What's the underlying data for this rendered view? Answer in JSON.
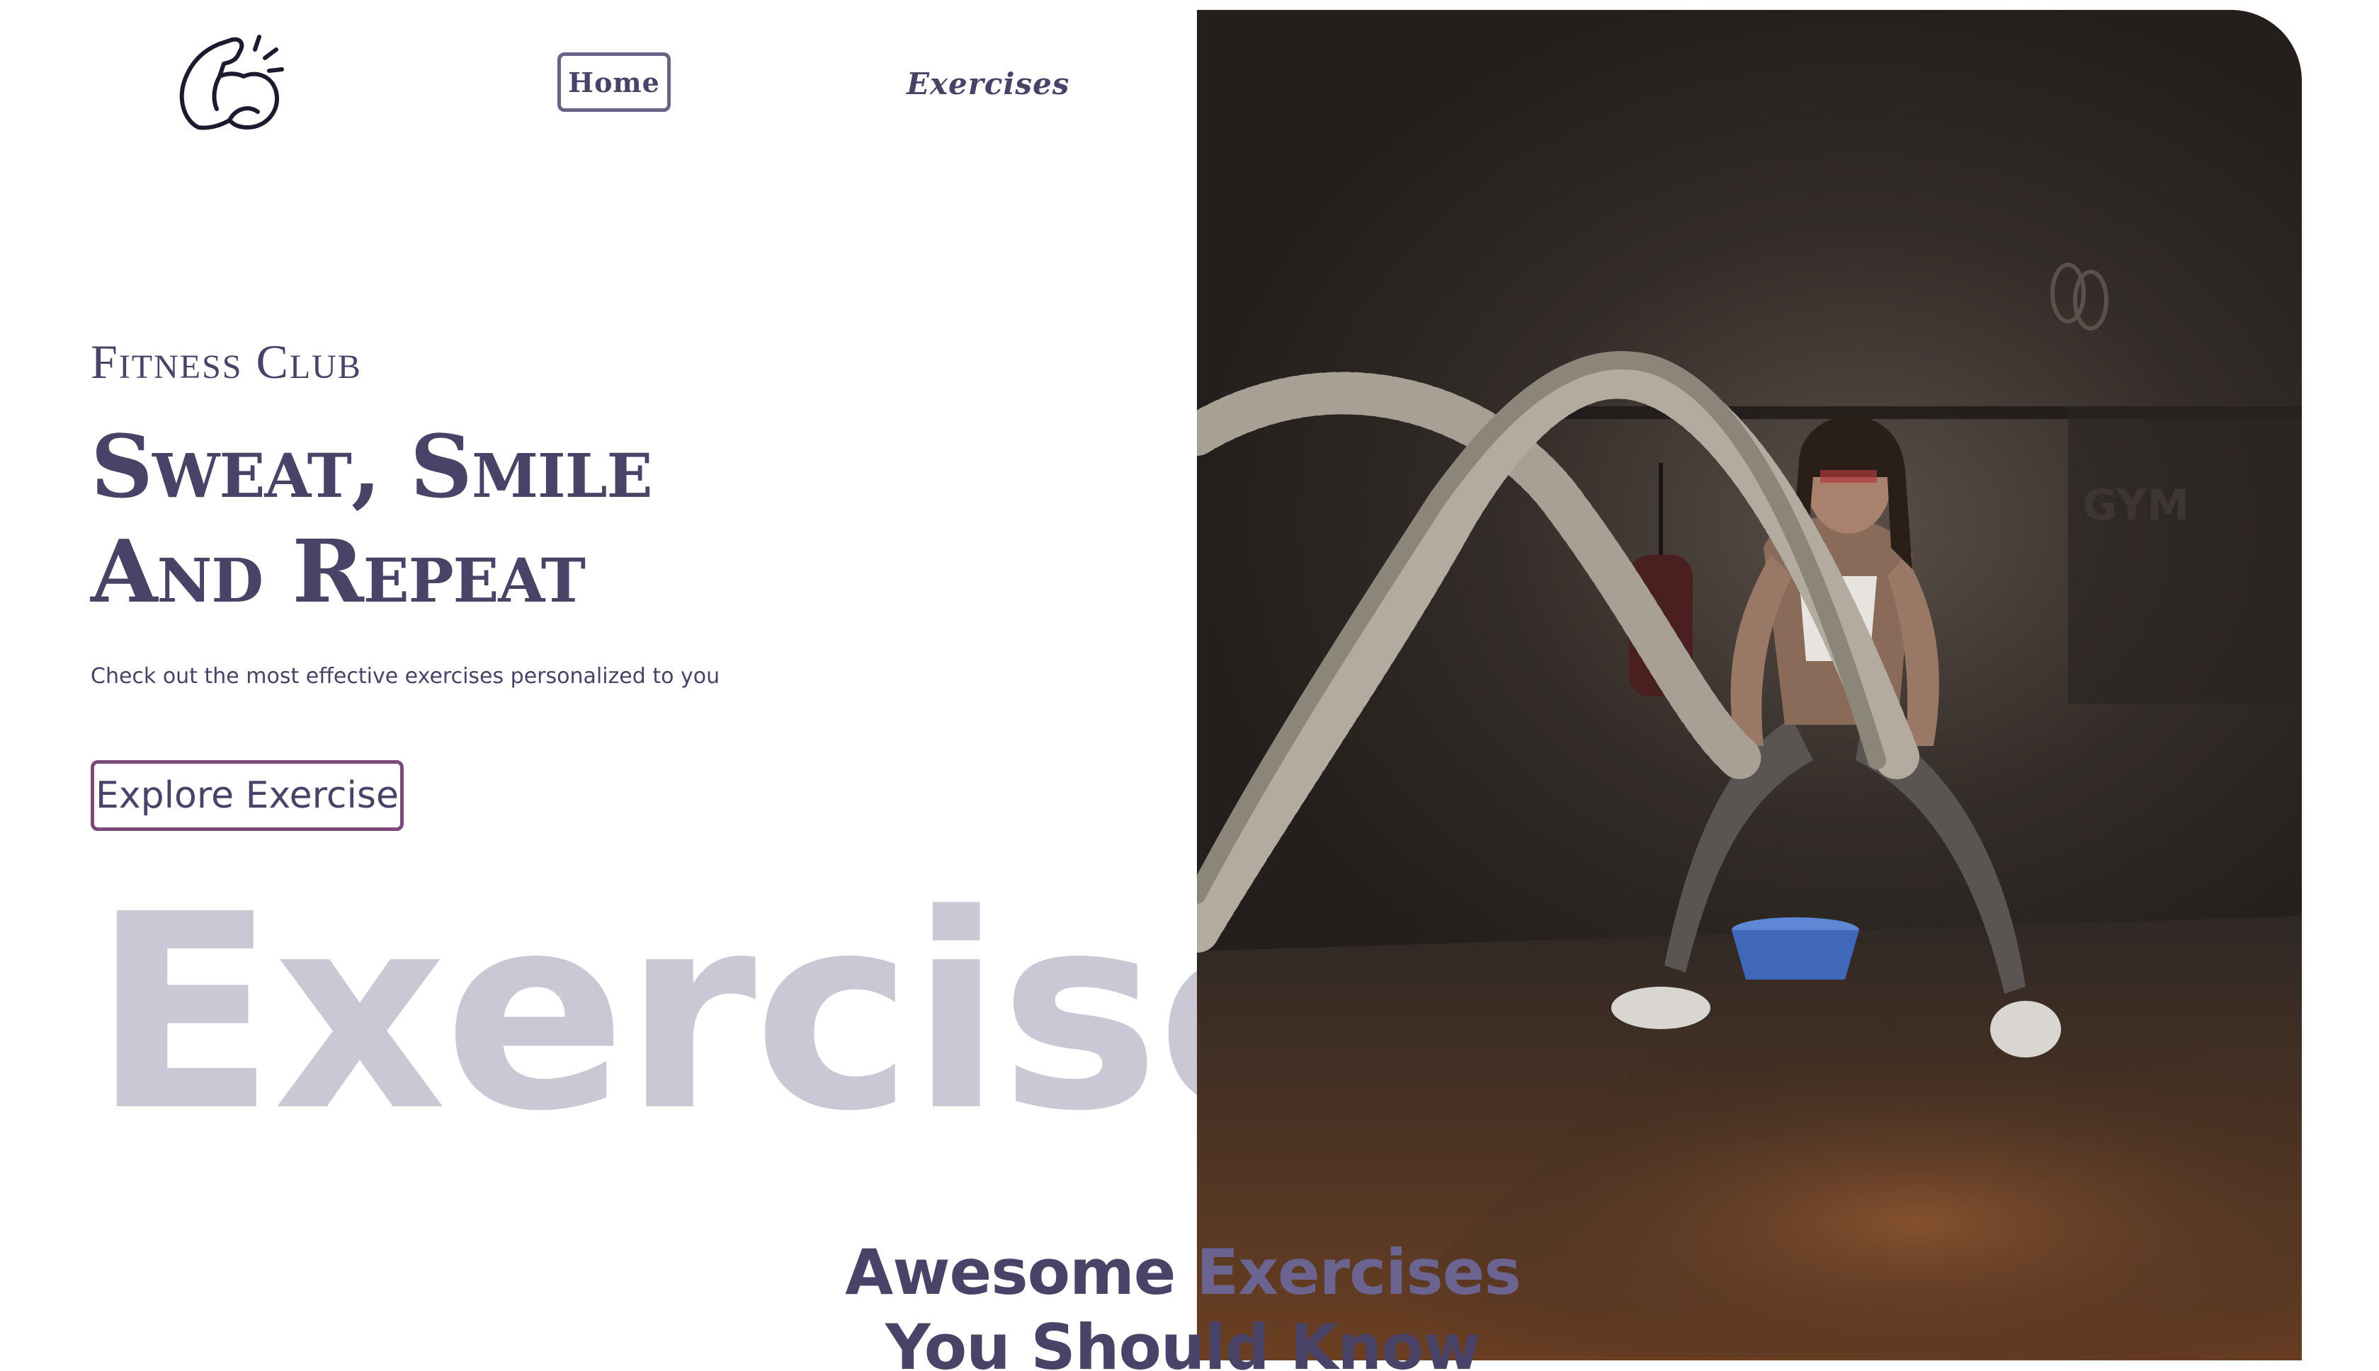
{
  "nav": {
    "logo_icon": "flexed-bicep-icon",
    "home_label": "Home",
    "exercises_label": "Exercises"
  },
  "hero": {
    "eyebrow": "Fitness Club",
    "headline_line1": "Sweat, Smile",
    "headline_line2": "And Repeat",
    "tagline": "Check out the most effective exercises personalized to you",
    "cta_label": "Explore Exercise",
    "image_icon": "battle-ropes-photo"
  },
  "background_word": "Exercises",
  "section": {
    "title_part1": "Awesome",
    "title_accent": "Exercises",
    "title_line2": "You Should Know"
  },
  "colors": {
    "primary": "#4a4368",
    "accent": "#6b6390",
    "ghost": "#cbc8d6",
    "button_border": "#7a4a7a"
  }
}
